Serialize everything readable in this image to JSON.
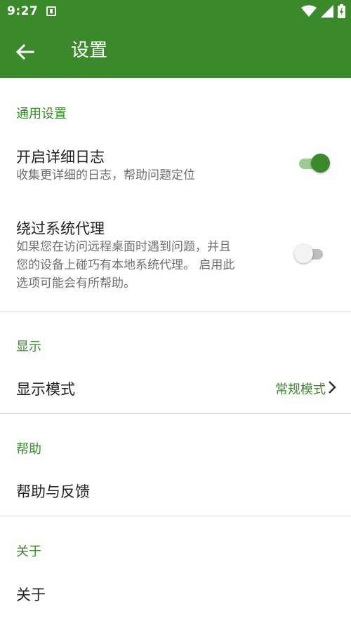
{
  "status_bar": {
    "time": "9:27",
    "icons": [
      "notification-a-icon",
      "wifi-icon",
      "signal-icon",
      "battery-charging-icon"
    ]
  },
  "toolbar": {
    "title": "设置",
    "back_icon": "arrow-back-icon"
  },
  "sections": {
    "general": {
      "header": "通用设置",
      "verbose_log": {
        "title": "开启详细日志",
        "summary": "收集更详细的日志，帮助问题定位",
        "enabled": true
      },
      "bypass_proxy": {
        "title": "绕过系统代理",
        "summary_lines": [
          "如果您在访问远程桌面时遇到问题，并且",
          "您的设备上碰巧有本地系统代理。 启用此",
          "选项可能会有所帮助。"
        ],
        "enabled": false
      }
    },
    "display": {
      "header": "显示",
      "mode": {
        "title": "显示模式",
        "value": "常规模式"
      }
    },
    "help": {
      "header": "帮助",
      "feedback": {
        "title": "帮助与反馈"
      }
    },
    "about": {
      "header": "关于",
      "item": {
        "title": "关于"
      }
    }
  },
  "colors": {
    "accent": "#3a8a2c",
    "switch_track_on": "#9ccb95",
    "summary_text": "#6f6f6f"
  }
}
